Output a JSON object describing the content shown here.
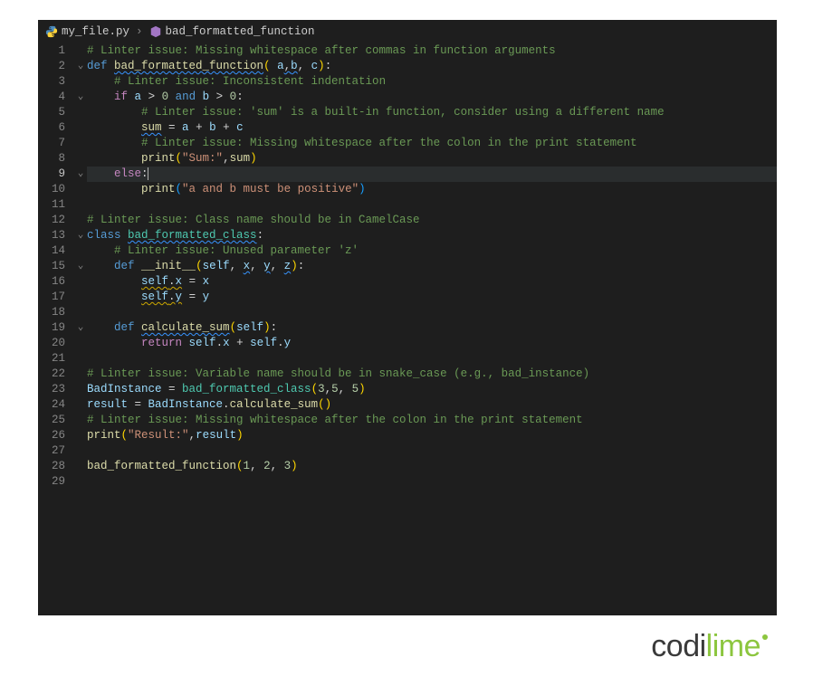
{
  "breadcrumb": {
    "file": "my_file.py",
    "symbol": "bad_formatted_function"
  },
  "current_line": 9,
  "fold_markers": {
    "2": "v",
    "4": "v",
    "9": "v",
    "13": "v",
    "15": "v",
    "19": "v"
  },
  "logo": {
    "part1": "codi",
    "part2": "lime"
  },
  "code": {
    "1": [
      {
        "t": "# Linter issue: Missing whitespace after commas in function arguments",
        "c": "tk-cm"
      }
    ],
    "2": [
      {
        "t": "def",
        "c": "tk-blue"
      },
      {
        "t": " ",
        "c": "tk-def"
      },
      {
        "t": "bad_formatted_function",
        "c": "tk-fn squig-b"
      },
      {
        "t": "(",
        "c": "tk-par"
      },
      {
        "t": " ",
        "c": "tk-def"
      },
      {
        "t": "a",
        "c": "tk-selfv"
      },
      {
        "t": ",",
        "c": "tk-op squig-b"
      },
      {
        "t": "b",
        "c": "tk-selfv squig-b"
      },
      {
        "t": ", ",
        "c": "tk-op"
      },
      {
        "t": "c",
        "c": "tk-selfv"
      },
      {
        "t": ")",
        "c": "tk-par"
      },
      {
        "t": ":",
        "c": "tk-op"
      }
    ],
    "3": [
      {
        "t": "    ",
        "c": ""
      },
      {
        "t": "# Linter issue: Inconsistent indentation",
        "c": "tk-cm"
      }
    ],
    "4": [
      {
        "t": "    ",
        "c": ""
      },
      {
        "t": "if",
        "c": "tk-kw"
      },
      {
        "t": " ",
        "c": ""
      },
      {
        "t": "a",
        "c": "tk-selfv"
      },
      {
        "t": " > ",
        "c": "tk-op"
      },
      {
        "t": "0",
        "c": "tk-num"
      },
      {
        "t": " ",
        "c": ""
      },
      {
        "t": "and",
        "c": "tk-blue"
      },
      {
        "t": " ",
        "c": ""
      },
      {
        "t": "b",
        "c": "tk-selfv"
      },
      {
        "t": " > ",
        "c": "tk-op"
      },
      {
        "t": "0",
        "c": "tk-num"
      },
      {
        "t": ":",
        "c": "tk-op"
      }
    ],
    "5": [
      {
        "t": "        ",
        "c": ""
      },
      {
        "t": "# Linter issue: 'sum' is a built-in function, consider using a different name",
        "c": "tk-cm"
      }
    ],
    "6": [
      {
        "t": "        ",
        "c": ""
      },
      {
        "t": "sum",
        "c": "tk-fn squig-b"
      },
      {
        "t": " = ",
        "c": "tk-op"
      },
      {
        "t": "a",
        "c": "tk-selfv"
      },
      {
        "t": " + ",
        "c": "tk-op"
      },
      {
        "t": "b",
        "c": "tk-selfv"
      },
      {
        "t": " + ",
        "c": "tk-op"
      },
      {
        "t": "c",
        "c": "tk-selfv"
      }
    ],
    "7": [
      {
        "t": "        ",
        "c": ""
      },
      {
        "t": "# Linter issue: Missing whitespace after the colon in the print statement",
        "c": "tk-cm"
      }
    ],
    "8": [
      {
        "t": "        ",
        "c": ""
      },
      {
        "t": "print",
        "c": "tk-fn"
      },
      {
        "t": "(",
        "c": "tk-par"
      },
      {
        "t": "\"Sum:\"",
        "c": "tk-str"
      },
      {
        "t": ",",
        "c": "tk-op"
      },
      {
        "t": "sum",
        "c": "tk-fn"
      },
      {
        "t": ")",
        "c": "tk-par"
      }
    ],
    "9": [
      {
        "t": "    ",
        "c": ""
      },
      {
        "t": "else",
        "c": "tk-kw"
      },
      {
        "t": ":",
        "c": "tk-op"
      }
    ],
    "10": [
      {
        "t": "        ",
        "c": ""
      },
      {
        "t": "print",
        "c": "tk-fn"
      },
      {
        "t": "(",
        "c": "tk-bb"
      },
      {
        "t": "\"a and b must be positive\"",
        "c": "tk-str"
      },
      {
        "t": ")",
        "c": "tk-bb"
      }
    ],
    "11": [],
    "12": [
      {
        "t": "# Linter issue: Class name should be in CamelCase",
        "c": "tk-cm"
      }
    ],
    "13": [
      {
        "t": "class",
        "c": "tk-blue"
      },
      {
        "t": " ",
        "c": ""
      },
      {
        "t": "bad_formatted_class",
        "c": "tk-cls squig-b"
      },
      {
        "t": ":",
        "c": "tk-op"
      }
    ],
    "14": [
      {
        "t": "    ",
        "c": ""
      },
      {
        "t": "# Linter issue: Unused parameter 'z'",
        "c": "tk-cm"
      }
    ],
    "15": [
      {
        "t": "    ",
        "c": ""
      },
      {
        "t": "def",
        "c": "tk-blue"
      },
      {
        "t": " ",
        "c": ""
      },
      {
        "t": "__init__",
        "c": "tk-fn"
      },
      {
        "t": "(",
        "c": "tk-par"
      },
      {
        "t": "self",
        "c": "tk-selfv"
      },
      {
        "t": ", ",
        "c": "tk-op"
      },
      {
        "t": "x",
        "c": "tk-selfv squig-b"
      },
      {
        "t": ", ",
        "c": "tk-op"
      },
      {
        "t": "y",
        "c": "tk-selfv squig-b"
      },
      {
        "t": ", ",
        "c": "tk-op"
      },
      {
        "t": "z",
        "c": "tk-selfv squig-b"
      },
      {
        "t": ")",
        "c": "tk-par"
      },
      {
        "t": ":",
        "c": "tk-op"
      }
    ],
    "16": [
      {
        "t": "        ",
        "c": ""
      },
      {
        "t": "self",
        "c": "tk-selfv squig-y"
      },
      {
        "t": ".",
        "c": "tk-op squig-y"
      },
      {
        "t": "x",
        "c": "tk-selfv squig-y"
      },
      {
        "t": " = ",
        "c": "tk-op"
      },
      {
        "t": "x",
        "c": "tk-selfv"
      }
    ],
    "17": [
      {
        "t": "        ",
        "c": ""
      },
      {
        "t": "self",
        "c": "tk-selfv squig-y"
      },
      {
        "t": ".",
        "c": "tk-op squig-y"
      },
      {
        "t": "y",
        "c": "tk-selfv squig-y"
      },
      {
        "t": " = ",
        "c": "tk-op"
      },
      {
        "t": "y",
        "c": "tk-selfv"
      }
    ],
    "18": [],
    "19": [
      {
        "t": "    ",
        "c": ""
      },
      {
        "t": "def",
        "c": "tk-blue"
      },
      {
        "t": " ",
        "c": ""
      },
      {
        "t": "calculate_sum",
        "c": "tk-fn squig-b"
      },
      {
        "t": "(",
        "c": "tk-par"
      },
      {
        "t": "self",
        "c": "tk-selfv"
      },
      {
        "t": ")",
        "c": "tk-par"
      },
      {
        "t": ":",
        "c": "tk-op"
      }
    ],
    "20": [
      {
        "t": "        ",
        "c": ""
      },
      {
        "t": "return",
        "c": "tk-kw"
      },
      {
        "t": " ",
        "c": ""
      },
      {
        "t": "self",
        "c": "tk-selfv"
      },
      {
        "t": ".",
        "c": "tk-op"
      },
      {
        "t": "x",
        "c": "tk-selfv"
      },
      {
        "t": " + ",
        "c": "tk-op"
      },
      {
        "t": "self",
        "c": "tk-selfv"
      },
      {
        "t": ".",
        "c": "tk-op"
      },
      {
        "t": "y",
        "c": "tk-selfv"
      }
    ],
    "21": [],
    "22": [
      {
        "t": "# Linter issue: Variable name should be in snake_case (e.g., bad_instance)",
        "c": "tk-cm"
      }
    ],
    "23": [
      {
        "t": "BadInstance",
        "c": "tk-selfv"
      },
      {
        "t": " = ",
        "c": "tk-op"
      },
      {
        "t": "bad_formatted_class",
        "c": "tk-cls"
      },
      {
        "t": "(",
        "c": "tk-par"
      },
      {
        "t": "3",
        "c": "tk-num"
      },
      {
        "t": ",",
        "c": "tk-op"
      },
      {
        "t": "5",
        "c": "tk-num"
      },
      {
        "t": ", ",
        "c": "tk-op"
      },
      {
        "t": "5",
        "c": "tk-num"
      },
      {
        "t": ")",
        "c": "tk-par"
      }
    ],
    "24": [
      {
        "t": "result",
        "c": "tk-selfv"
      },
      {
        "t": " = ",
        "c": "tk-op"
      },
      {
        "t": "BadInstance",
        "c": "tk-selfv"
      },
      {
        "t": ".",
        "c": "tk-op"
      },
      {
        "t": "calculate_sum",
        "c": "tk-fn"
      },
      {
        "t": "(",
        "c": "tk-par"
      },
      {
        "t": ")",
        "c": "tk-par"
      }
    ],
    "25": [
      {
        "t": "# Linter issue: Missing whitespace after the colon in the print statement",
        "c": "tk-cm"
      }
    ],
    "26": [
      {
        "t": "print",
        "c": "tk-fn"
      },
      {
        "t": "(",
        "c": "tk-par"
      },
      {
        "t": "\"Result:\"",
        "c": "tk-str"
      },
      {
        "t": ",",
        "c": "tk-op"
      },
      {
        "t": "result",
        "c": "tk-selfv"
      },
      {
        "t": ")",
        "c": "tk-par"
      }
    ],
    "27": [],
    "28": [
      {
        "t": "bad_formatted_function",
        "c": "tk-fn"
      },
      {
        "t": "(",
        "c": "tk-par"
      },
      {
        "t": "1",
        "c": "tk-num"
      },
      {
        "t": ", ",
        "c": "tk-op"
      },
      {
        "t": "2",
        "c": "tk-num"
      },
      {
        "t": ", ",
        "c": "tk-op"
      },
      {
        "t": "3",
        "c": "tk-num"
      },
      {
        "t": ")",
        "c": "tk-par"
      }
    ],
    "29": []
  },
  "line_count": 29
}
